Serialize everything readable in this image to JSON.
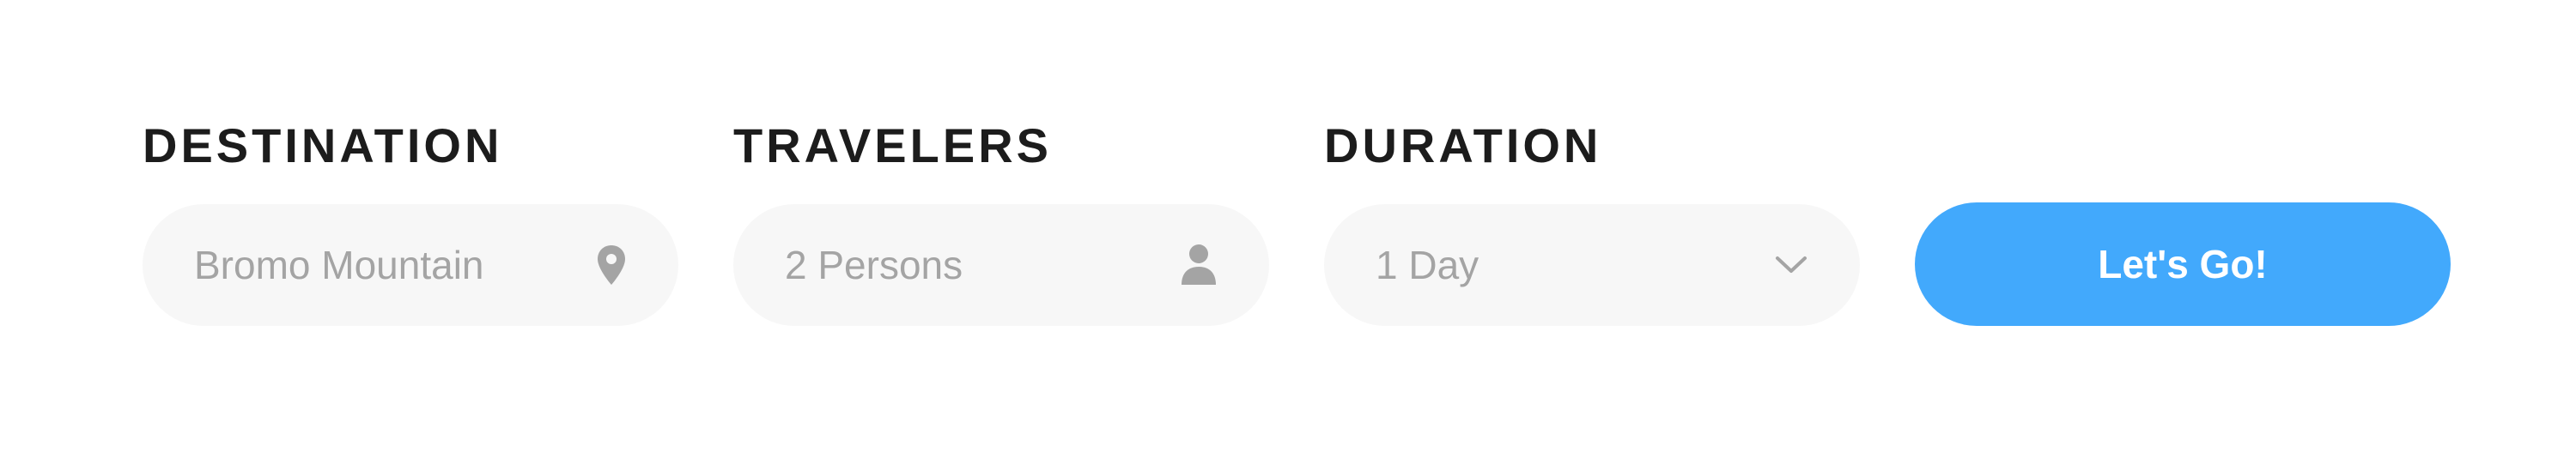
{
  "search_form": {
    "destination": {
      "label": "DESTINATION",
      "value": "Bromo Mountain",
      "icon": "map-pin-icon"
    },
    "travelers": {
      "label": "TRAVELERS",
      "value": "2 Persons",
      "icon": "person-icon"
    },
    "duration": {
      "label": "DURATION",
      "value": "1 Day",
      "icon": "chevron-down-icon"
    },
    "submit_label": "Let's Go!"
  },
  "colors": {
    "accent": "#42a9fc",
    "field_background": "#f7f7f7",
    "label_text": "#1c1c1c",
    "value_text": "#a4a4a4",
    "button_text": "#ffffff"
  }
}
